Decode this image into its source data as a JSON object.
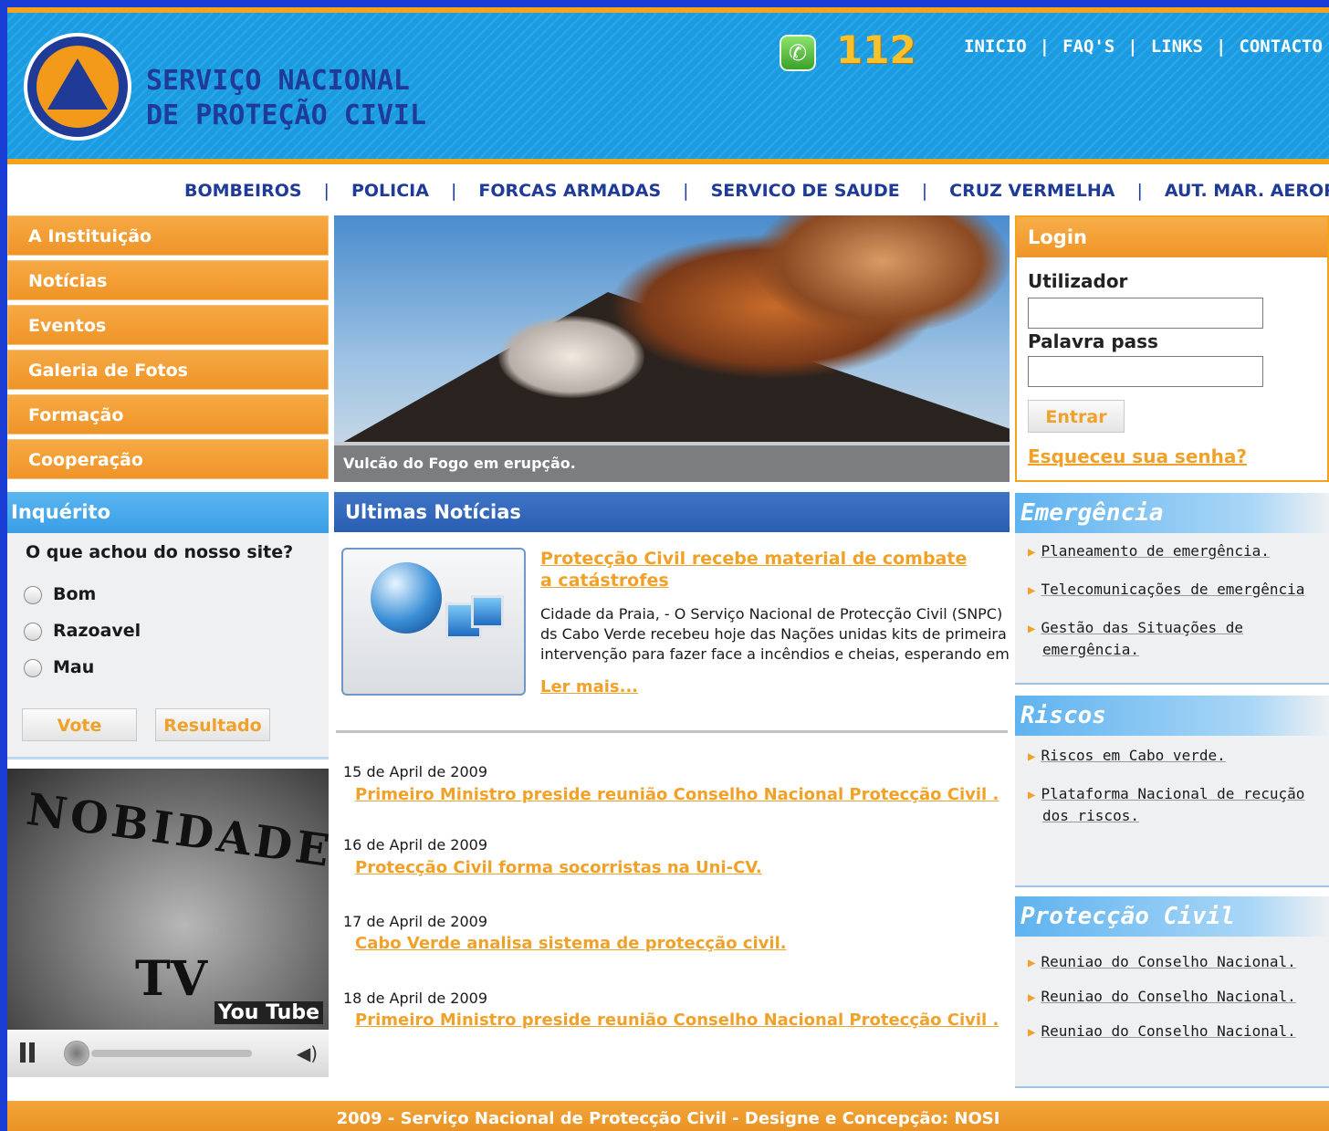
{
  "header": {
    "site_title_line1": "SERVIÇO NACIONAL",
    "site_title_line2": "DE PROTEÇÃO CIVIL",
    "emergency_number": "112",
    "top_nav": [
      "INICIO",
      "FAQ'S",
      "LINKS",
      "CONTACTO"
    ]
  },
  "secondary_nav": [
    "BOMBEIROS",
    "POLICIA",
    "FORCAS ARMADAS",
    "SERVICO DE SAUDE",
    "CRUZ VERMELHA",
    "AUT. MAR. AEROP"
  ],
  "left_menu": [
    "A Instituição",
    "Notícias",
    "Eventos",
    "Galeria de Fotos",
    "Formação",
    "Cooperação"
  ],
  "poll": {
    "title": "Inquérito",
    "question": "O que achou do nosso site?",
    "options": [
      "Bom",
      "Razoavel",
      "Mau"
    ],
    "vote_label": "Vote",
    "results_label": "Resultado"
  },
  "video": {
    "word": "NOBIDADE",
    "tv": "TV",
    "logo": "You Tube"
  },
  "hero": {
    "caption": "Vulcão do Fogo em erupção."
  },
  "news": {
    "title": "Ultimas Notícias",
    "featured_title": "Protecção Civil recebe material de combate a catástrofes",
    "featured_body": "Cidade da Praia, - O Serviço Nacional de Protecção Civil (SNPC) ds Cabo Verde recebeu hoje das Nações unidas kits de primeira intervenção para fazer face a incêndios e cheias, esperando em",
    "read_more": "Ler mais...",
    "items": [
      {
        "date": "15 de April de 2009",
        "title": "Primeiro Ministro preside reunião Conselho Nacional  Protecção Civil ."
      },
      {
        "date": "16 de April de 2009",
        "title": "Protecção Civil forma socorristas na Uni-CV."
      },
      {
        "date": "17 de April de 2009",
        "title": "Cabo Verde analisa sistema de protecção civil."
      },
      {
        "date": "18 de April de 2009",
        "title": "Primeiro Ministro preside reunião Conselho Nacional  Protecção Civil ."
      }
    ]
  },
  "login": {
    "title": "Login",
    "user_label": "Utilizador",
    "user_value": "",
    "pass_label": "Palavra pass",
    "pass_value": "",
    "submit_label": "Entrar",
    "forgot_label": "Esqueceu sua senha?"
  },
  "emergencia": {
    "title": "Emergência",
    "items": [
      "Planeamento de emergência.",
      "Telecomunicações de emergência",
      "Gestão das Situações de",
      "emergência."
    ]
  },
  "riscos": {
    "title": "Riscos",
    "items": [
      "Riscos em Cabo verde.",
      "Plataforma Nacional de recução",
      "dos riscos."
    ]
  },
  "proteccao": {
    "title": "Protecção Civil",
    "items": [
      "Reuniao do Conselho Nacional.",
      "Reuniao do Conselho Nacional.",
      "Reuniao do Conselho Nacional."
    ]
  },
  "footer": {
    "text": "2009 - Serviço Nacional de Protecção Civil - Designe e Concepção: NOSI"
  },
  "colors": {
    "page_border": "#1a3dd6",
    "accent_orange": "#f0a12a",
    "header_blue": "#1c9be0",
    "title_navy": "#1f3b97"
  }
}
